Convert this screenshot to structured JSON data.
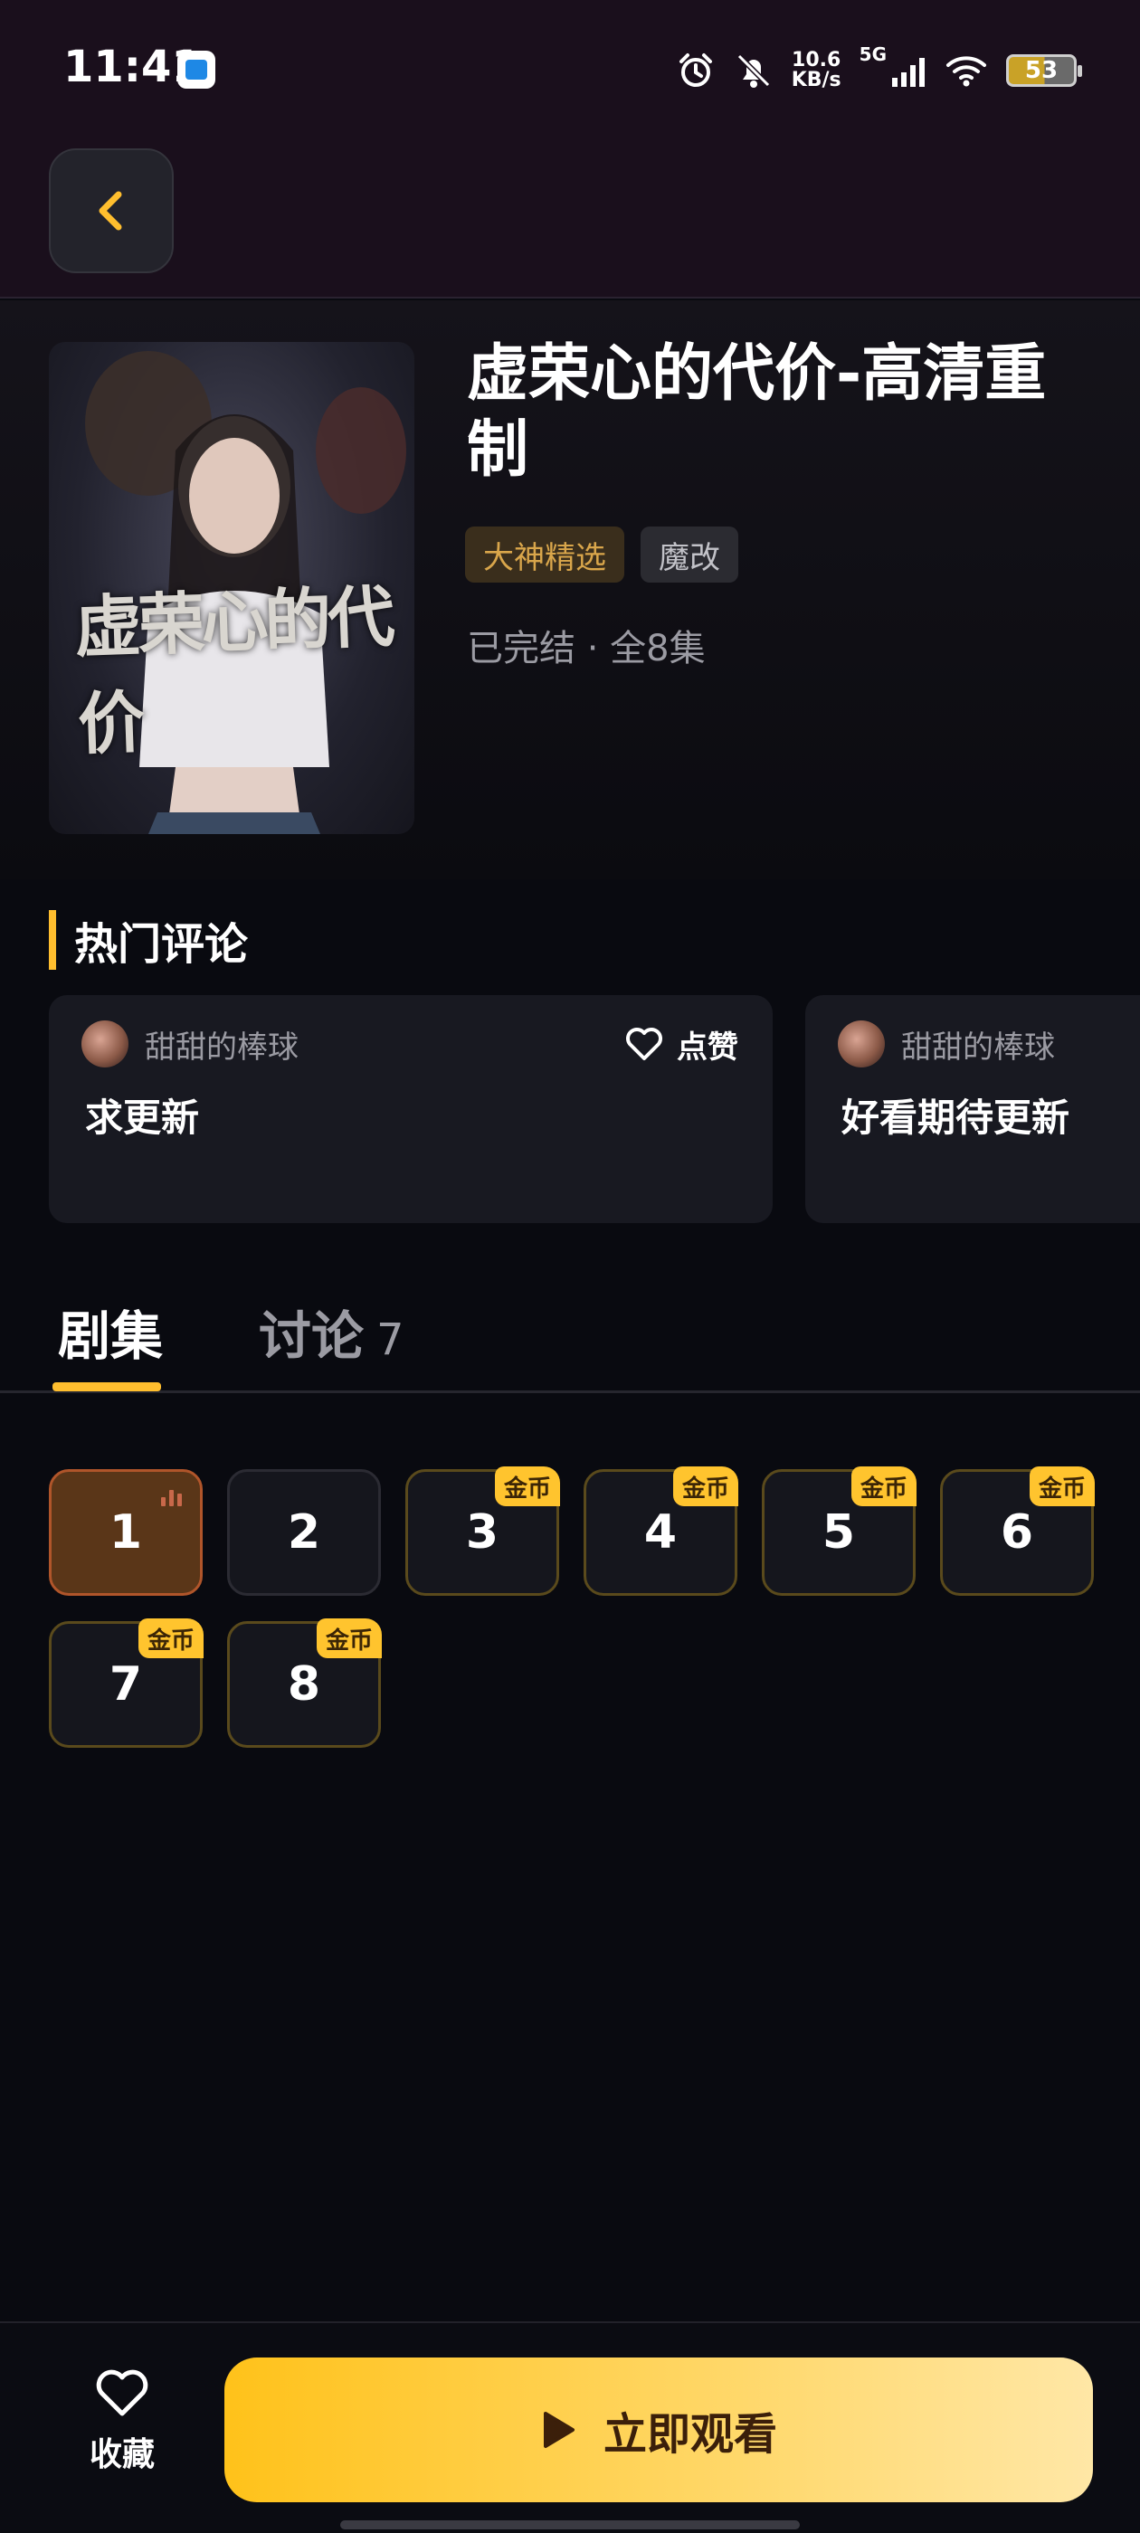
{
  "status_bar": {
    "time": "11:41",
    "net_speed_value": "10.6",
    "net_speed_unit": "KB/s",
    "signal_label": "5G",
    "battery_level": "53",
    "icons": [
      "alarm-icon",
      "bell-muted-icon",
      "signal-icon",
      "wifi-icon",
      "battery-icon"
    ]
  },
  "header": {
    "back_icon": "chevron-left-icon"
  },
  "show": {
    "title": "虚荣心的代价-高清重制",
    "poster_title": "虚荣心的代价",
    "tags": [
      "大神精选",
      "魔改"
    ],
    "meta": "已完结 · 全8集"
  },
  "comments": {
    "section_title": "热门评论",
    "like_label": "点赞",
    "items": [
      {
        "user": "甜甜的棒球",
        "text": "求更新"
      },
      {
        "user": "甜甜的棒球",
        "text": "好看期待更新"
      }
    ]
  },
  "tabs": {
    "episodes_label": "剧集",
    "discuss_label": "讨论",
    "discuss_count": "7",
    "active": "剧集"
  },
  "episodes": {
    "coin_label": "金币",
    "items": [
      {
        "number": "1",
        "locked": false,
        "playing": true
      },
      {
        "number": "2",
        "locked": false,
        "playing": false
      },
      {
        "number": "3",
        "locked": true,
        "playing": false
      },
      {
        "number": "4",
        "locked": true,
        "playing": false
      },
      {
        "number": "5",
        "locked": true,
        "playing": false
      },
      {
        "number": "6",
        "locked": true,
        "playing": false
      },
      {
        "number": "7",
        "locked": true,
        "playing": false
      },
      {
        "number": "8",
        "locked": true,
        "playing": false
      }
    ]
  },
  "bottom_bar": {
    "favorite_label": "收藏",
    "watch_label": "立即观看"
  },
  "colors": {
    "accent": "#ffbe2e",
    "background": "#090a10",
    "header_background": "#1a0f1c",
    "card_background": "#181921",
    "coin_badge": "#ffc42e"
  }
}
